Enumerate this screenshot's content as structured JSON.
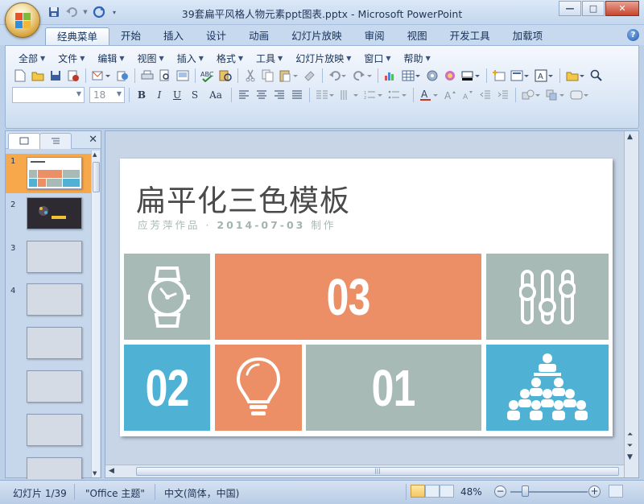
{
  "window": {
    "title": "39套扁平风格人物元素ppt图表.pptx - Microsoft PowerPoint",
    "controls": {
      "minimize": "—",
      "maximize": "□",
      "close": "✕"
    }
  },
  "ribbon": {
    "tabs": [
      "经典菜单",
      "开始",
      "插入",
      "设计",
      "动画",
      "幻灯片放映",
      "审阅",
      "视图",
      "开发工具",
      "加载项"
    ],
    "active_tab": "经典菜单",
    "help": "?",
    "menus": [
      "全部",
      "文件",
      "编辑",
      "视图",
      "插入",
      "格式",
      "工具",
      "幻灯片放映",
      "窗口",
      "帮助"
    ],
    "font_name": "",
    "font_size": "18",
    "format_buttons": [
      "B",
      "I",
      "U",
      "S",
      "Aa"
    ]
  },
  "left_pane": {
    "slide_numbers": [
      "1",
      "2",
      "3",
      "4"
    ],
    "close": "✕"
  },
  "slide": {
    "title": "扁平化三色模板",
    "subtitle_author": "应芳萍作品 · ",
    "subtitle_date": "2014-07-03",
    "subtitle_suffix": " 制作",
    "tiles": {
      "t03": "03",
      "t02": "02",
      "t01": "01"
    },
    "colors": {
      "gray": "#a7bab6",
      "orange": "#ec8f67",
      "blue": "#4fb2d5"
    }
  },
  "status": {
    "slide_info": "幻灯片 1/39",
    "theme": "\"Office 主题\"",
    "language": "中文(简体，中国)",
    "zoom": "48%"
  }
}
